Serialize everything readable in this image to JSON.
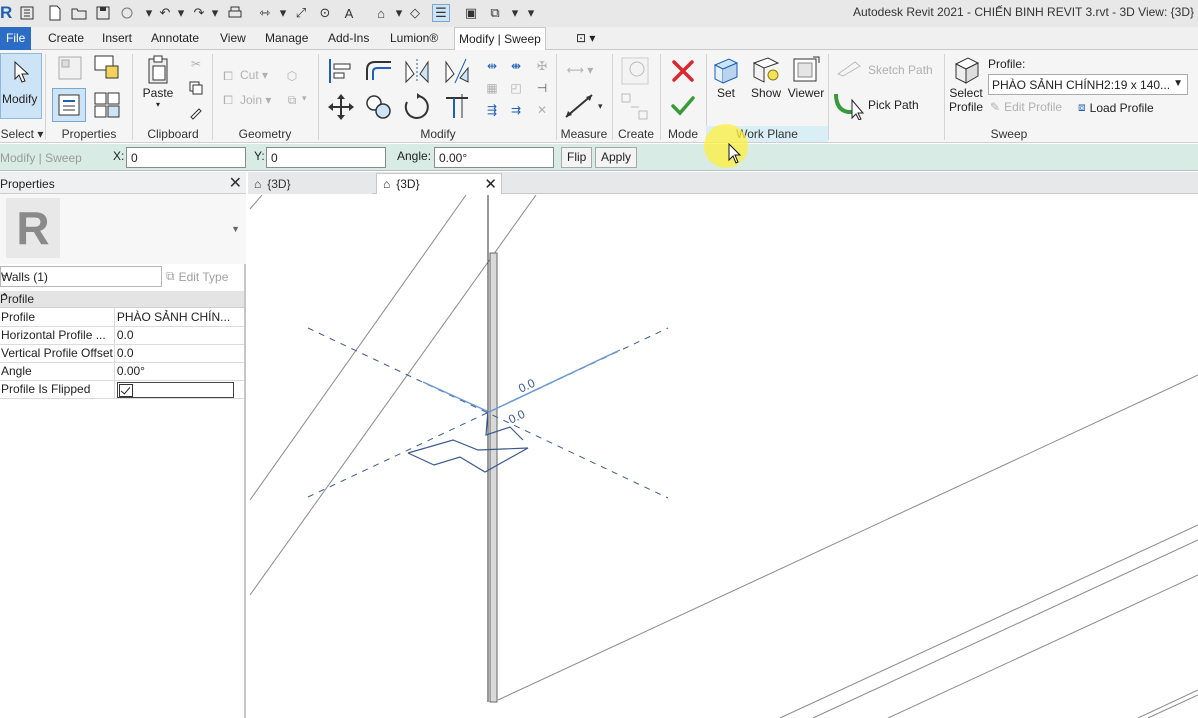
{
  "app": {
    "title": "Autodesk Revit 2021 - CHIẾN BINH REVIT 3.rvt - 3D View: {3D}",
    "logo": "R"
  },
  "tabs": [
    {
      "label": "File"
    },
    {
      "label": "Create"
    },
    {
      "label": "Insert"
    },
    {
      "label": "Annotate"
    },
    {
      "label": "View"
    },
    {
      "label": "Manage"
    },
    {
      "label": "Add-Ins"
    },
    {
      "label": "Lumion®"
    },
    {
      "label": "Modify | Sweep"
    }
  ],
  "ribbon": {
    "modify_label": "Modify",
    "select_label": "Select",
    "panels": {
      "properties": "Properties",
      "clipboard": "Clipboard",
      "geometry": "Geometry",
      "modify": "Modify",
      "measure": "Measure",
      "create": "Create",
      "mode": "Mode",
      "work_plane": "Work Plane",
      "sweep": "Sweep"
    },
    "paste_label": "Paste",
    "cut_label": "Cut",
    "join_label": "Join",
    "set_label": "Set",
    "show_label": "Show",
    "viewer_label": "Viewer",
    "sketch_path_label": "Sketch Path",
    "pick_path_label": "Pick Path",
    "select_profile_label_1": "Select",
    "select_profile_label_2": "Profile",
    "profile_label": "Profile:",
    "profile_value": "PHÀO SẢNH CHÍNH2:19 x 140...",
    "edit_profile_label": "Edit Profile",
    "load_profile_label": "Load Profile"
  },
  "options_bar": {
    "context": "Modify | Sweep",
    "x_label": "X:",
    "x_value": "0",
    "y_label": "Y:",
    "y_value": "0",
    "angle_label": "Angle:",
    "angle_value": "0.00°",
    "flip_label": "Flip",
    "apply_label": "Apply"
  },
  "properties": {
    "title": "Properties",
    "type_logo": "R",
    "filter_value": "Walls (1)",
    "edit_type_label": "Edit Type",
    "group_label": "Profile",
    "rows": [
      {
        "key": "Profile",
        "value": "PHÀO SẢNH CHÍN..."
      },
      {
        "key": "Horizontal Profile ...",
        "value": "0.0"
      },
      {
        "key": "Vertical Profile Offset",
        "value": "0.0"
      },
      {
        "key": "Angle",
        "value": "0.00°"
      },
      {
        "key": "Profile Is Flipped",
        "value": ""
      }
    ]
  },
  "view_tabs": [
    {
      "label": "{3D}",
      "active": false
    },
    {
      "label": "{3D}",
      "active": true
    }
  ],
  "canvas": {
    "dim_label_1": "0.0",
    "dim_label_2": "0.0"
  },
  "colors": {
    "accent": "#2b6cc4",
    "options_bar": "#d8ece5",
    "cancel_red": "#d9282f",
    "finish_green": "#3a9a3a",
    "work_plane_label_bg": "#d9eef5"
  }
}
